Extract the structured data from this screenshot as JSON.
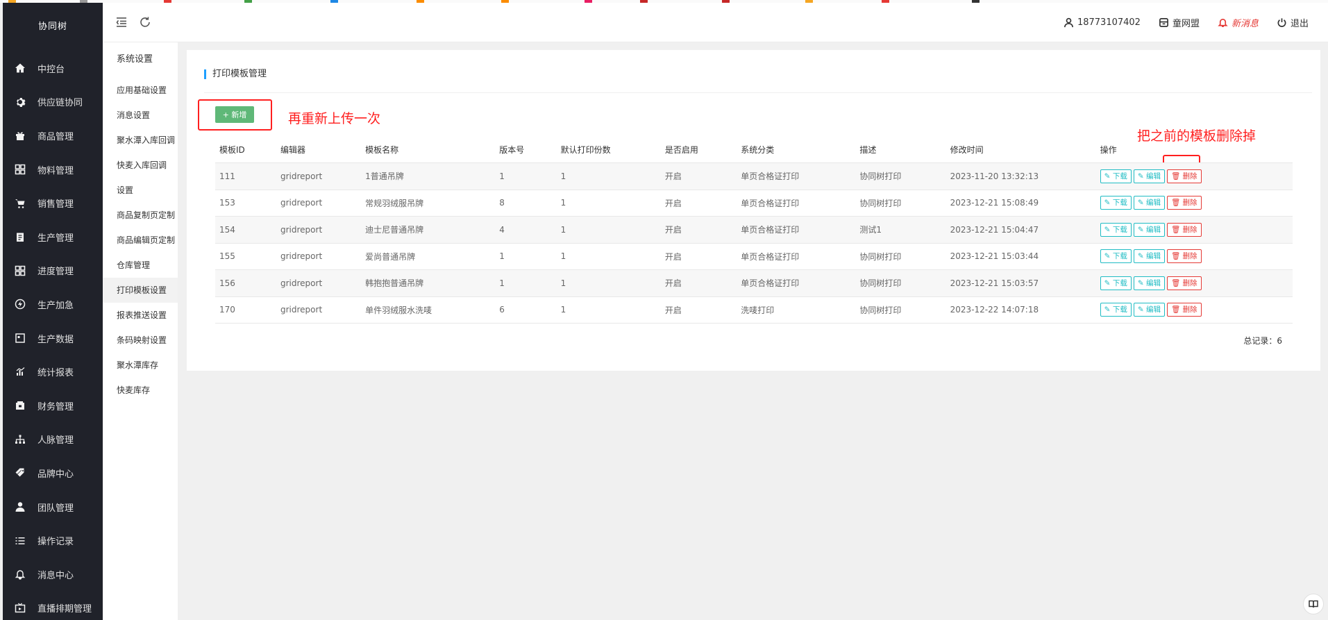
{
  "brand": "协同树",
  "nav": [
    {
      "label": "中控台",
      "icon": "home-icon"
    },
    {
      "label": "供应链协同",
      "icon": "gear-icon"
    },
    {
      "label": "商品管理",
      "icon": "gift-icon"
    },
    {
      "label": "物料管理",
      "icon": "grid-icon"
    },
    {
      "label": "销售管理",
      "icon": "cart-icon"
    },
    {
      "label": "生产管理",
      "icon": "clipboard-icon"
    },
    {
      "label": "进度管理",
      "icon": "grid-icon"
    },
    {
      "label": "生产加急",
      "icon": "bolt-icon"
    },
    {
      "label": "生产数据",
      "icon": "data-icon"
    },
    {
      "label": "统计报表",
      "icon": "chart-icon"
    },
    {
      "label": "财务管理",
      "icon": "wallet-icon"
    },
    {
      "label": "人脉管理",
      "icon": "sitemap-icon"
    },
    {
      "label": "品牌中心",
      "icon": "tag-icon"
    },
    {
      "label": "团队管理",
      "icon": "user-icon"
    },
    {
      "label": "操作记录",
      "icon": "list-icon"
    },
    {
      "label": "消息中心",
      "icon": "bell-icon"
    },
    {
      "label": "直播排期管理",
      "icon": "tv-icon"
    }
  ],
  "submenu": {
    "title": "系统设置",
    "items": [
      {
        "label": "应用基础设置"
      },
      {
        "label": "消息设置"
      },
      {
        "label": "聚水潭入库回调"
      },
      {
        "label": "快麦入库回调设置"
      },
      {
        "label": "商品复制页定制"
      },
      {
        "label": "商品编辑页定制"
      },
      {
        "label": "仓库管理"
      },
      {
        "label": "打印模板设置"
      },
      {
        "label": "报表推送设置"
      },
      {
        "label": "条码映射设置"
      },
      {
        "label": "聚水潭库存"
      },
      {
        "label": "快麦库存"
      }
    ]
  },
  "topbar": {
    "phone": "18773107402",
    "alliance": "童网盟",
    "new_message": "新消息",
    "logout": "退出"
  },
  "card": {
    "title": "打印模板管理",
    "add_button": "+ 新增",
    "total": "总记录：6"
  },
  "annotations": {
    "reupload": "再重新上传一次",
    "delete_old": "把之前的模板删除掉"
  },
  "table": {
    "columns": [
      "模板ID",
      "编辑器",
      "模板名称",
      "版本号",
      "默认打印份数",
      "是否启用",
      "系统分类",
      "描述",
      "修改时间",
      "操作"
    ],
    "rows": [
      [
        "111",
        "gridreport",
        "1普通吊牌",
        "1",
        "1",
        "开启",
        "单页合格证打印",
        "协同树打印",
        "2023-11-20 13:32:13"
      ],
      [
        "153",
        "gridreport",
        "常规羽绒服吊牌",
        "8",
        "1",
        "开启",
        "单页合格证打印",
        "协同树打印",
        "2023-12-21 15:08:49"
      ],
      [
        "154",
        "gridreport",
        "迪士尼普通吊牌",
        "4",
        "1",
        "开启",
        "单页合格证打印",
        "测试1",
        "2023-12-21 15:04:47"
      ],
      [
        "155",
        "gridreport",
        "爱尚普通吊牌",
        "1",
        "1",
        "开启",
        "单页合格证打印",
        "协同树打印",
        "2023-12-21 15:03:44"
      ],
      [
        "156",
        "gridreport",
        "韩抱抱普通吊牌",
        "1",
        "1",
        "开启",
        "单页合格证打印",
        "协同树打印",
        "2023-12-21 15:03:57"
      ],
      [
        "170",
        "gridreport",
        "单件羽绒服水洗唛",
        "6",
        "1",
        "开启",
        "洗唛打印",
        "协同树打印",
        "2023-12-22 14:07:18"
      ]
    ],
    "actions": {
      "download": "下载",
      "edit": "编辑",
      "delete": "删除"
    }
  },
  "colors": {
    "sidebar_bg": "#20222a",
    "accent_blue": "#1e9fff",
    "add_green": "#5fb878",
    "action_teal": "#1fbcc4",
    "danger_red": "#e53935",
    "annotation_red": "#ff1f1f"
  }
}
